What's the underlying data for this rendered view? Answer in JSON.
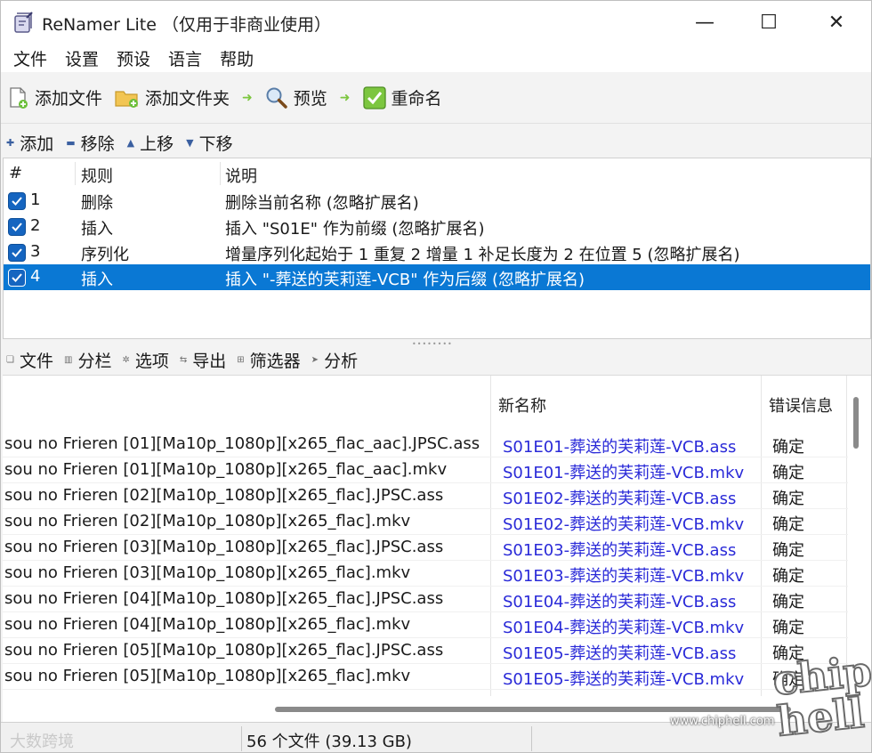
{
  "window": {
    "title": "ReNamer Lite （仅用于非商业使用）",
    "minimize_glyph": "—",
    "maximize_glyph": "☐",
    "close_glyph": "✕"
  },
  "menu": [
    "文件",
    "设置",
    "预设",
    "语言",
    "帮助"
  ],
  "toolbar": {
    "add_files": "添加文件",
    "add_folders": "添加文件夹",
    "preview": "预览",
    "rename": "重命名"
  },
  "rules_toolbar": {
    "add": "添加",
    "remove": "移除",
    "move_up": "上移",
    "move_down": "下移"
  },
  "rules": {
    "headers": {
      "num": "#",
      "rule": "规则",
      "desc": "说明"
    },
    "rows": [
      {
        "num": "1",
        "rule": "删除",
        "desc": "删除当前名称 (忽略扩展名)"
      },
      {
        "num": "2",
        "rule": "插入",
        "desc": "插入 \"S01E\" 作为前缀 (忽略扩展名)"
      },
      {
        "num": "3",
        "rule": "序列化",
        "desc": "增量序列化起始于 1 重复 2 增量 1 补足长度为 2 在位置 5 (忽略扩展名)"
      },
      {
        "num": "4",
        "rule": "插入",
        "desc": "插入 \"-葬送的芙莉莲-VCB\" 作为后缀 (忽略扩展名)"
      }
    ],
    "selected_index": 3
  },
  "files_toolbar": {
    "files": "文件",
    "columns": "分栏",
    "options": "选项",
    "export": "导出",
    "filters": "筛选器",
    "analyze": "分析"
  },
  "files": {
    "headers": {
      "new_name": "新名称",
      "error": "错误信息"
    },
    "rows": [
      {
        "old": "sou no Frieren [01][Ma10p_1080p][x265_flac_aac].JPSC.ass",
        "new": "S01E01-葬送的芙莉莲-VCB.ass",
        "err": "确定"
      },
      {
        "old": "sou no Frieren [01][Ma10p_1080p][x265_flac_aac].mkv",
        "new": "S01E01-葬送的芙莉莲-VCB.mkv",
        "err": "确定"
      },
      {
        "old": "sou no Frieren [02][Ma10p_1080p][x265_flac].JPSC.ass",
        "new": "S01E02-葬送的芙莉莲-VCB.ass",
        "err": "确定"
      },
      {
        "old": "sou no Frieren [02][Ma10p_1080p][x265_flac].mkv",
        "new": "S01E02-葬送的芙莉莲-VCB.mkv",
        "err": "确定"
      },
      {
        "old": "sou no Frieren [03][Ma10p_1080p][x265_flac].JPSC.ass",
        "new": "S01E03-葬送的芙莉莲-VCB.ass",
        "err": "确定"
      },
      {
        "old": "sou no Frieren [03][Ma10p_1080p][x265_flac].mkv",
        "new": "S01E03-葬送的芙莉莲-VCB.mkv",
        "err": "确定"
      },
      {
        "old": "sou no Frieren [04][Ma10p_1080p][x265_flac].JPSC.ass",
        "new": "S01E04-葬送的芙莉莲-VCB.ass",
        "err": "确定"
      },
      {
        "old": "sou no Frieren [04][Ma10p_1080p][x265_flac].mkv",
        "new": "S01E04-葬送的芙莉莲-VCB.mkv",
        "err": "确定"
      },
      {
        "old": "sou no Frieren [05][Ma10p_1080p][x265_flac].JPSC.ass",
        "new": "S01E05-葬送的芙莉莲-VCB.ass",
        "err": "确定"
      },
      {
        "old": "sou no Frieren [05][Ma10p_1080p][x265_flac].mkv",
        "new": "S01E05-葬送的芙莉莲-VCB.mkv",
        "err": "确定"
      }
    ]
  },
  "status": {
    "summary": "56 个文件 (39.13 GB)",
    "ghost_text": "大数跨境"
  },
  "watermark": {
    "logo": "chip hell",
    "url": "www.chiphell.com"
  },
  "colors": {
    "selection": "#0a78d4",
    "new_name_text": "#2a2ad8",
    "checkbox": "#1565c0",
    "arrow_green": "#7cc63f"
  }
}
